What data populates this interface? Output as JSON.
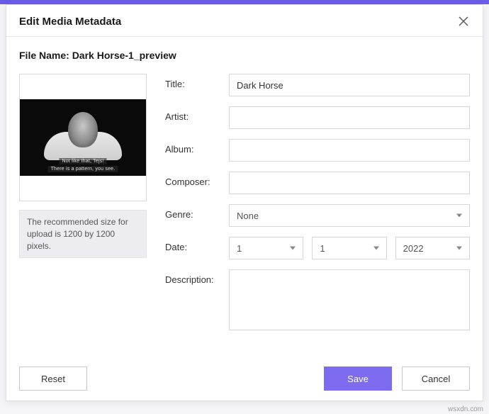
{
  "dialog": {
    "title": "Edit Media Metadata",
    "filename_label": "File Name: Dark Horse-1_preview"
  },
  "preview": {
    "subtitle1": "Not like that, Tejs!",
    "subtitle2": "There is a pattern, you see.",
    "recommendation": "The recommended size for upload is 1200 by 1200 pixels."
  },
  "form": {
    "labels": {
      "title": "Title:",
      "artist": "Artist:",
      "album": "Album:",
      "composer": "Composer:",
      "genre": "Genre:",
      "date": "Date:",
      "description": "Description:"
    },
    "values": {
      "title": "Dark Horse",
      "artist": "",
      "album": "",
      "composer": "",
      "genre": "None",
      "date_day": "1",
      "date_month": "1",
      "date_year": "2022",
      "description": ""
    }
  },
  "buttons": {
    "reset": "Reset",
    "save": "Save",
    "cancel": "Cancel"
  },
  "watermark": "wsxdn.com"
}
